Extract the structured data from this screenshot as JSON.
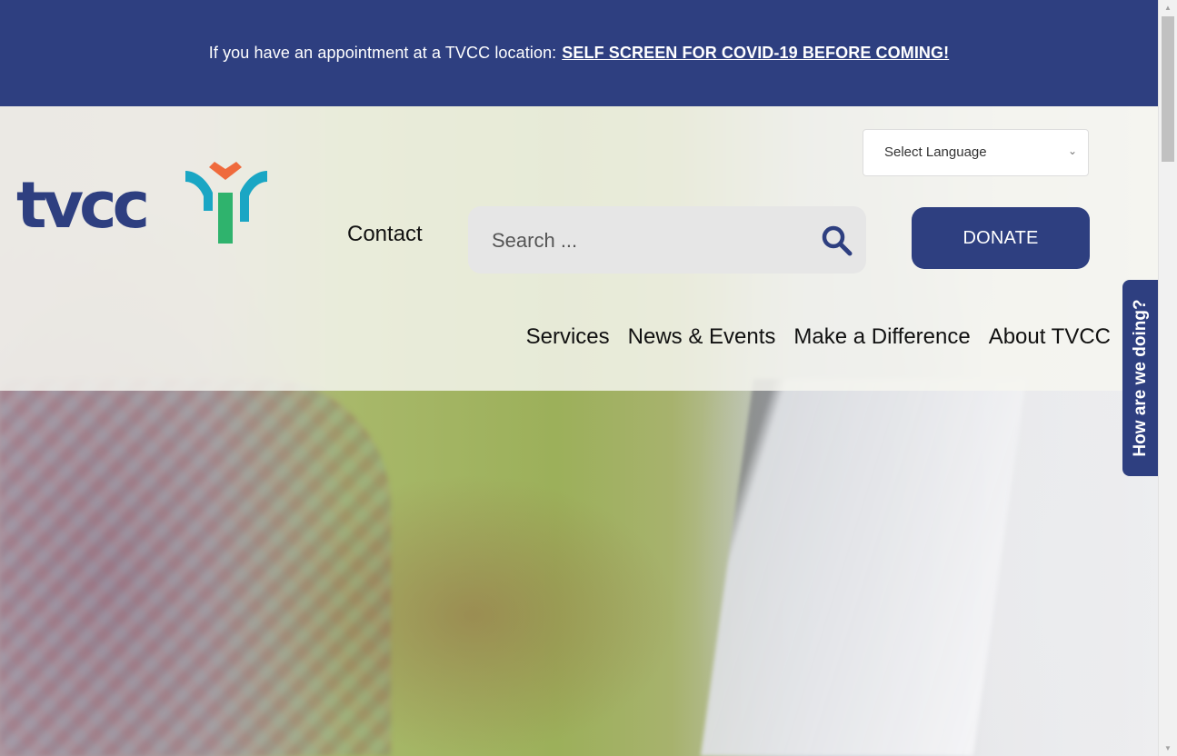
{
  "alert_bar": {
    "text": "If you have an appointment at a TVCC location:",
    "link_label": "SELF SCREEN FOR COVID-19 BEFORE COMING!"
  },
  "header": {
    "logo_text": "tvcc",
    "contact_label": "Contact",
    "search": {
      "placeholder": "Search ..."
    },
    "language_select": {
      "selected": "Select Language"
    },
    "donate_label": "DONATE",
    "nav_items": [
      "Services",
      "News & Events",
      "Make a Difference",
      "About TVCC"
    ]
  },
  "feedback_tab": {
    "label": "How are we doing?"
  },
  "colors": {
    "brand_navy": "#2e3f80",
    "logo_orange": "#ef6a3c",
    "logo_teal": "#1aa6c4",
    "logo_green": "#2fb36d"
  },
  "icons": {
    "search": "search-icon",
    "chevron": "chevron-down-icon",
    "scroll_up": "scroll-up-arrow-icon",
    "scroll_down": "scroll-down-arrow-icon"
  }
}
